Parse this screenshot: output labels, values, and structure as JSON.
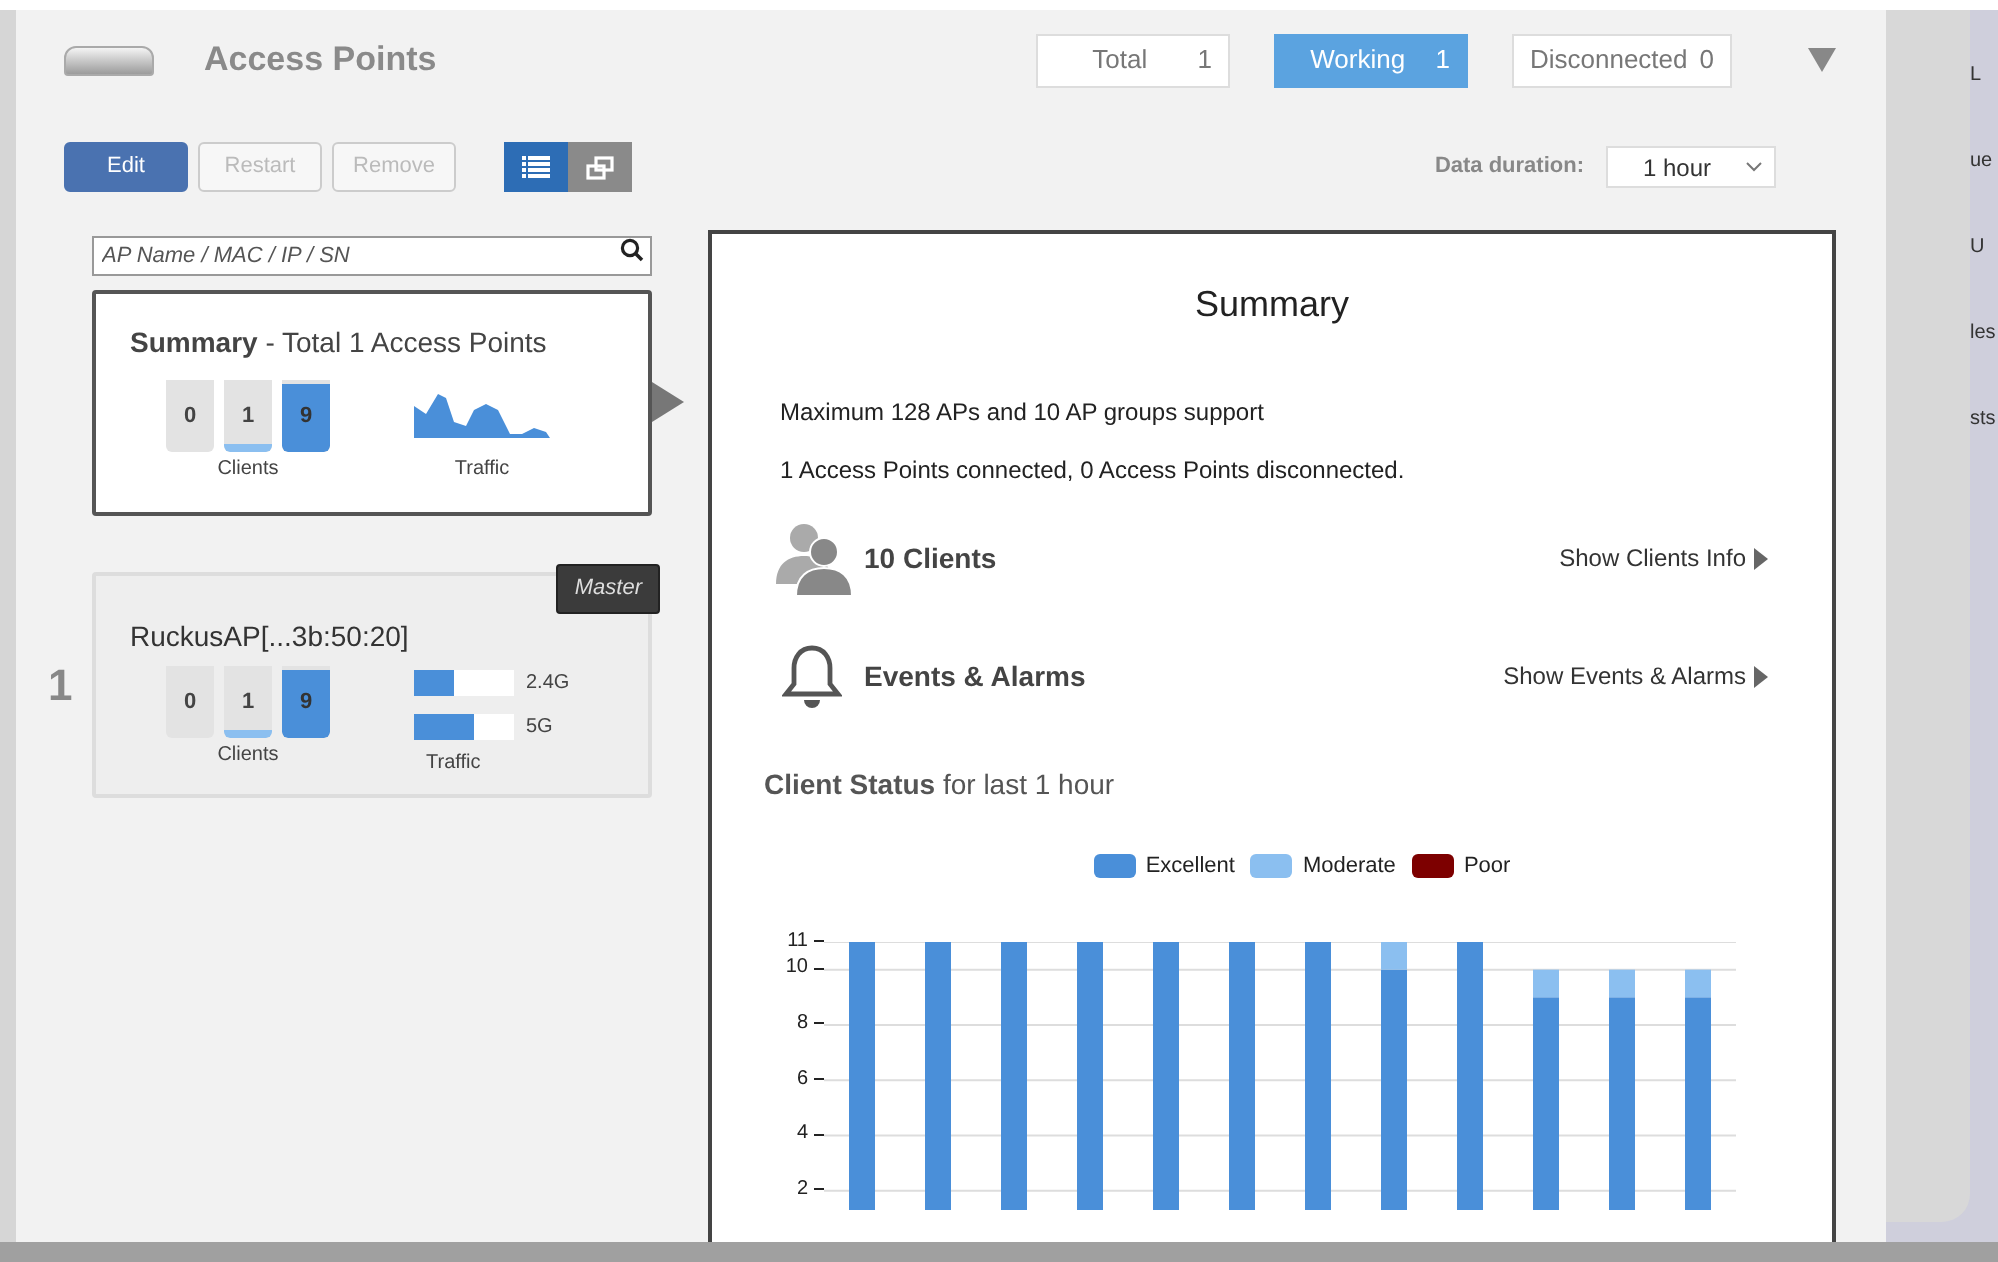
{
  "header": {
    "title": "Access Points",
    "stats": [
      {
        "label": "Total",
        "count": "1",
        "selected": false
      },
      {
        "label": "Working",
        "count": "1",
        "selected": true
      },
      {
        "label": "Disconnected",
        "count": "0",
        "selected": false
      }
    ]
  },
  "toolbar": {
    "buttons": [
      {
        "label": "Edit",
        "disabled": false
      },
      {
        "label": "Restart",
        "disabled": true
      },
      {
        "label": "Remove",
        "disabled": true
      }
    ],
    "views": [
      {
        "kind": "list",
        "selected": true
      },
      {
        "kind": "cascade",
        "selected": false
      }
    ],
    "duration_label": "Data duration:",
    "duration_value": "1 hour"
  },
  "search": {
    "placeholder": "AP Name / MAC / IP / SN"
  },
  "summary_card": {
    "title": "Summary",
    "subtitle": " - Total 1 Access Points",
    "clients": [
      {
        "value": "0",
        "level": 0
      },
      {
        "value": "1",
        "level": 0.1
      },
      {
        "value": "9",
        "level": 0.95
      }
    ],
    "clients_label": "Clients",
    "traffic_label": "Traffic"
  },
  "ap_cards": [
    {
      "index": "1",
      "badge": "Master",
      "name": "RuckusAP[...3b:50:20]",
      "clients": [
        {
          "value": "0",
          "level": 0
        },
        {
          "value": "1",
          "level": 0.1
        },
        {
          "value": "9",
          "level": 0.95
        }
      ],
      "clients_label": "Clients",
      "traffic": [
        {
          "band": "2.4G",
          "level": 0.4
        },
        {
          "band": "5G",
          "level": 0.6
        }
      ],
      "traffic_label": "Traffic"
    }
  ],
  "detail": {
    "title": "Summary",
    "lines": [
      "Maximum 128 APs and 10 AP groups support",
      "1 Access Points connected, 0 Access Points disconnected."
    ],
    "sections": [
      {
        "kind": "clients",
        "title": "10 Clients",
        "link": "Show Clients Info"
      },
      {
        "kind": "events",
        "title": "Events & Alarms",
        "link": "Show Events & Alarms"
      }
    ],
    "chart_heading": "**Client Status** for last 1 hour",
    "chart_data": {
      "type": "bar",
      "stacked": true,
      "grid": true,
      "series": [
        {
          "name": "Excellent",
          "color": "#4a8fd9",
          "values": [
            11,
            11,
            11,
            11,
            11,
            11,
            11,
            10,
            11,
            9,
            9,
            9
          ]
        },
        {
          "name": "Moderate",
          "color": "#8bbff0",
          "values": [
            null,
            null,
            null,
            null,
            null,
            null,
            null,
            1,
            null,
            1,
            1,
            1
          ]
        },
        {
          "name": "Poor",
          "color": "#7d0000",
          "values": [
            null,
            null,
            null,
            null,
            null,
            null,
            null,
            null,
            null,
            null,
            null,
            null
          ]
        }
      ],
      "ylim": [
        0,
        11
      ],
      "yticks": [
        2,
        4,
        6,
        8,
        10,
        11
      ]
    }
  },
  "background_fragments": [
    "L",
    "ue",
    "U",
    "les",
    "sts"
  ]
}
